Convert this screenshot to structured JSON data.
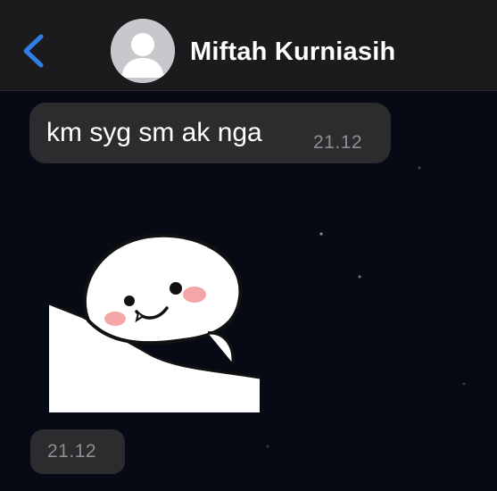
{
  "header": {
    "back_icon": "chevron-left-icon",
    "avatar_icon": "person-silhouette-icon",
    "contact_name": "Miftah Kurniasih",
    "accent_color": "#2f7fe6"
  },
  "messages": [
    {
      "type": "text",
      "text": "km syg sm ak nga",
      "time": "21.12"
    },
    {
      "type": "sticker",
      "sticker_icon": "smiling-white-blob-sticker",
      "time": "21.12"
    }
  ],
  "colors": {
    "header_bg": "#1b1b1d",
    "chat_bg": "#050a14",
    "bubble_bg": "#2c2c2e",
    "text": "#ffffff",
    "timestamp": "#8e8e93"
  }
}
